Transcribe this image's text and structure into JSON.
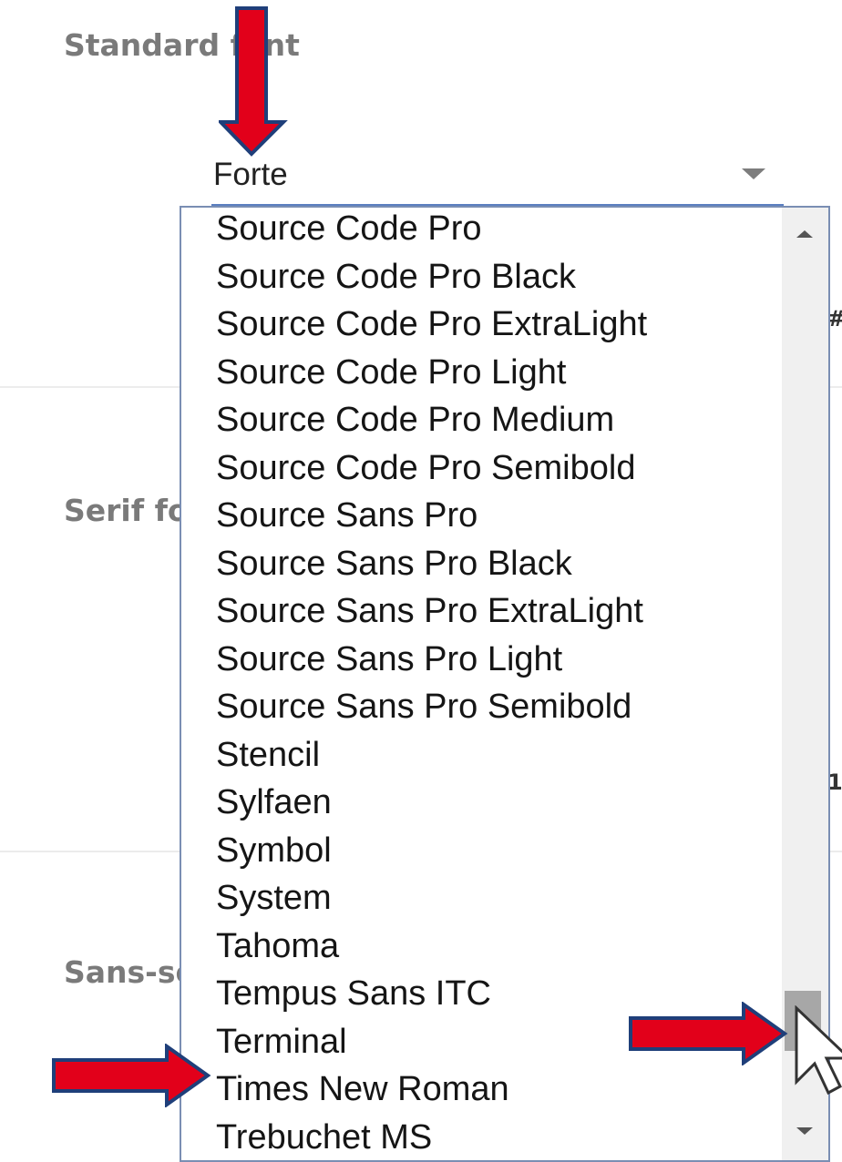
{
  "settings": {
    "standard_label": "Standard font",
    "serif_label": "Serif font",
    "sans_label": "Sans-serif font",
    "edge_glyph_top": "#",
    "edge_glyph_bottom": "1"
  },
  "font_select": {
    "selected_value": "Forte",
    "caret_icon": "triangle-down-icon"
  },
  "dropdown": {
    "options": [
      "Source Code Pro",
      "Source Code Pro Black",
      "Source Code Pro ExtraLight",
      "Source Code Pro Light",
      "Source Code Pro Medium",
      "Source Code Pro Semibold",
      "Source Sans Pro",
      "Source Sans Pro Black",
      "Source Sans Pro ExtraLight",
      "Source Sans Pro Light",
      "Source Sans Pro Semibold",
      "Stencil",
      "Sylfaen",
      "Symbol",
      "System",
      "Tahoma",
      "Tempus Sans ITC",
      "Terminal",
      "Times New Roman",
      "Trebuchet MS"
    ]
  },
  "annotations": {
    "arrow_color": "#e2001a",
    "arrow_outline": "#1f3f7a"
  }
}
